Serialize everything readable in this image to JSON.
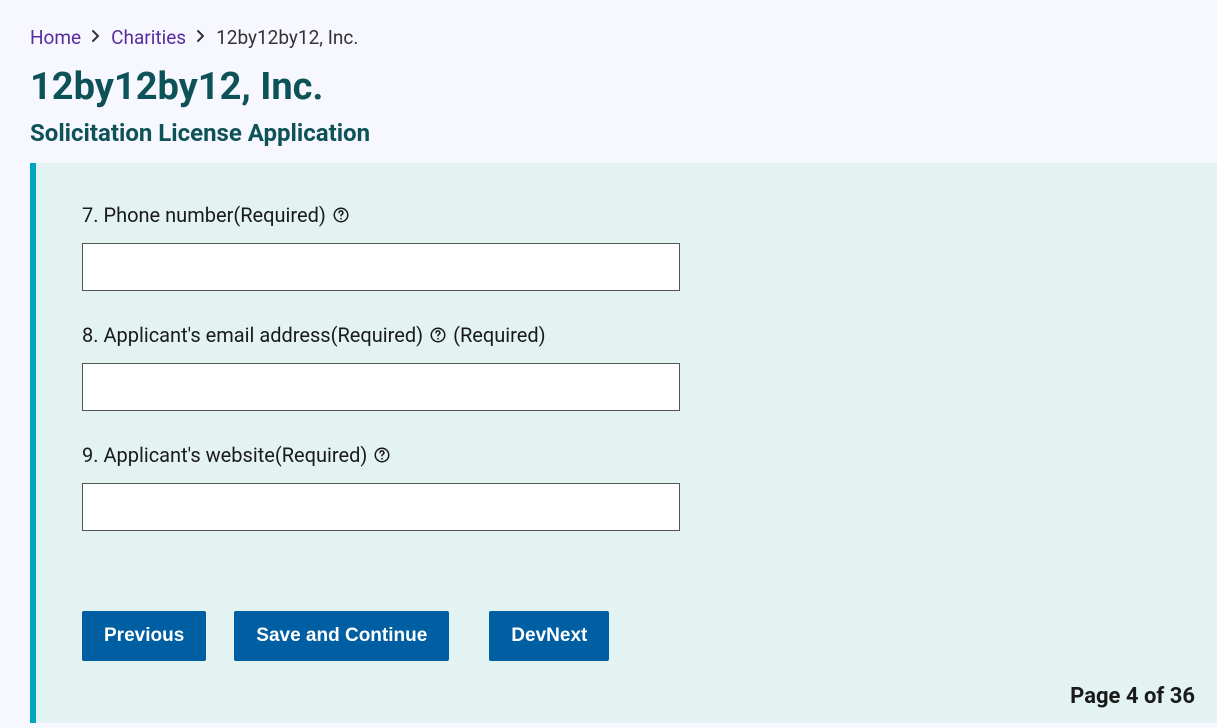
{
  "breadcrumb": {
    "home": "Home",
    "charities": "Charities",
    "current": "12by12by12, Inc."
  },
  "header": {
    "title": "12by12by12, Inc.",
    "subtitle": "Solicitation License Application"
  },
  "form": {
    "fields": [
      {
        "label": "7. Phone number(Required)",
        "extra": "",
        "value": ""
      },
      {
        "label": "8. Applicant's email address(Required)",
        "extra": "(Required)",
        "value": ""
      },
      {
        "label": "9. Applicant's website(Required)",
        "extra": "",
        "value": ""
      }
    ]
  },
  "buttons": {
    "previous": "Previous",
    "save": "Save and Continue",
    "devnext": "DevNext"
  },
  "pagination": {
    "text": "Page 4 of 36"
  }
}
